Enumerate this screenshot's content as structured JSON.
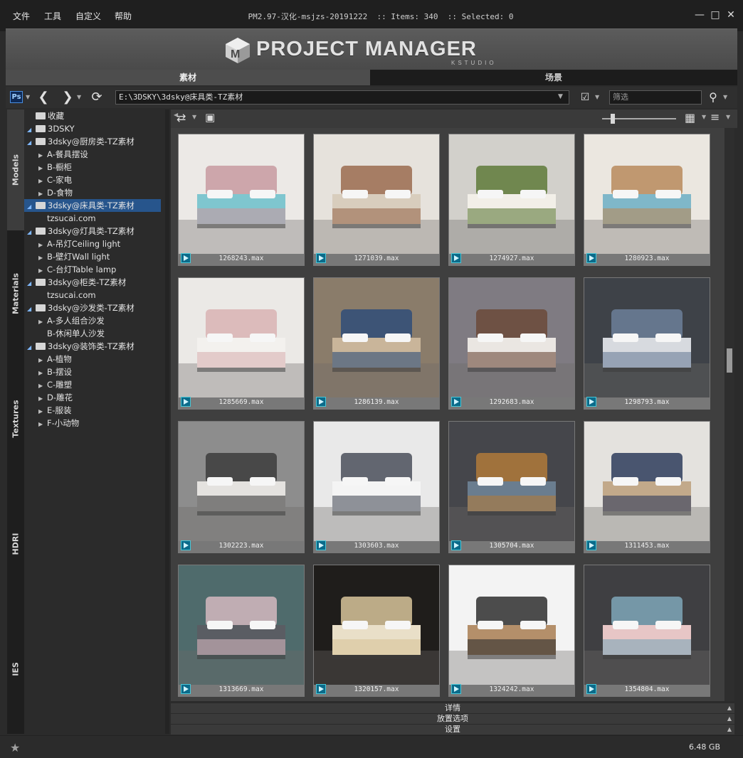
{
  "menu": [
    "文件",
    "工具",
    "自定义",
    "帮助"
  ],
  "title": "PM2.97-汉化-msjzs-20191222  :: Items: 340  :: Selected: 0",
  "banner": {
    "logo_text": "PROJECT MANAGER",
    "logo_sub": "KSTUDIO"
  },
  "tabs": {
    "assets": "素材",
    "scene": "场景"
  },
  "nav": {
    "path": "E:\\3DSKY\\3dsky@床具类-TZ素材",
    "filter_placeholder": "筛选",
    "ps_label": "Ps"
  },
  "vtabs": [
    "Models",
    "Materials",
    "Textures",
    "HDRI",
    "IES"
  ],
  "tree": [
    {
      "label": "收藏",
      "level": 0,
      "toggle": "",
      "star": true
    },
    {
      "label": "3DSKY",
      "level": 0,
      "toggle": "open"
    },
    {
      "label": "3dsky@厨房类-TZ素材",
      "level": 1,
      "toggle": "open"
    },
    {
      "label": "A-餐具摆设",
      "level": 2,
      "toggle": "closed"
    },
    {
      "label": "B-橱柜",
      "level": 2,
      "toggle": "closed"
    },
    {
      "label": "C-家电",
      "level": 2,
      "toggle": "closed"
    },
    {
      "label": "D-食物",
      "level": 2,
      "toggle": "closed"
    },
    {
      "label": "3dsky@床具类-TZ素材",
      "level": 1,
      "toggle": "open",
      "selected": true
    },
    {
      "label": "tzsucai.com",
      "level": 2,
      "toggle": ""
    },
    {
      "label": "3dsky@灯具类-TZ素材",
      "level": 1,
      "toggle": "open"
    },
    {
      "label": "A-吊灯Ceiling light",
      "level": 2,
      "toggle": "closed"
    },
    {
      "label": "B-壁灯Wall light",
      "level": 2,
      "toggle": "closed"
    },
    {
      "label": "C-台灯Table lamp",
      "level": 2,
      "toggle": "closed"
    },
    {
      "label": "3dsky@柜类-TZ素材",
      "level": 1,
      "toggle": "open"
    },
    {
      "label": "tzsucai.com",
      "level": 2,
      "toggle": ""
    },
    {
      "label": "3dsky@沙发类-TZ素材",
      "level": 1,
      "toggle": "open"
    },
    {
      "label": "A-多人组合沙发",
      "level": 2,
      "toggle": "closed"
    },
    {
      "label": "B-休闲单人沙发",
      "level": 2,
      "toggle": ""
    },
    {
      "label": "3dsky@装饰类-TZ素材",
      "level": 1,
      "toggle": "open"
    },
    {
      "label": "A-植物",
      "level": 2,
      "toggle": "closed"
    },
    {
      "label": "B-摆设",
      "level": 2,
      "toggle": "closed"
    },
    {
      "label": "C-雕塑",
      "level": 2,
      "toggle": "closed"
    },
    {
      "label": "D-雕花",
      "level": 2,
      "toggle": "closed"
    },
    {
      "label": "E-服装",
      "level": 2,
      "toggle": "closed"
    },
    {
      "label": "F-小动物",
      "level": 2,
      "toggle": "closed"
    }
  ],
  "items": [
    {
      "name": "1268243.max",
      "c1": "#ece9e6",
      "c2": "#c89aa0",
      "c3": "#7fc6cf"
    },
    {
      "name": "1271039.max",
      "c1": "#e6e2dc",
      "c2": "#9a6b4f",
      "c3": "#d8cdbd"
    },
    {
      "name": "1274927.max",
      "c1": "#d2d0cb",
      "c2": "#5f7a3a",
      "c3": "#f2efe8"
    },
    {
      "name": "1280923.max",
      "c1": "#ebe7e0",
      "c2": "#b98a5c",
      "c3": "#7fb7c9"
    },
    {
      "name": "1285669.max",
      "c1": "#ebe9e6",
      "c2": "#d9b3b3",
      "c3": "#f3f1ee"
    },
    {
      "name": "1286139.max",
      "c1": "#8a7c6a",
      "c2": "#2f4e78",
      "c3": "#c9b59a"
    },
    {
      "name": "1292683.max",
      "c1": "#7f7b82",
      "c2": "#6b4a3a",
      "c3": "#eae6e2"
    },
    {
      "name": "1298793.max",
      "c1": "#3e4248",
      "c2": "#6c7f9a",
      "c3": "#d7dadf"
    },
    {
      "name": "1302223.max",
      "c1": "#8d8d8d",
      "c2": "#3c3c3c",
      "c3": "#e4e2df"
    },
    {
      "name": "1303603.max",
      "c1": "#e9e9e9",
      "c2": "#4a4f5a",
      "c3": "#f4f4f4"
    },
    {
      "name": "1305704.max",
      "c1": "#45464b",
      "c2": "#b07a3a",
      "c3": "#6a7d8f"
    },
    {
      "name": "1311453.max",
      "c1": "#e4e2de",
      "c2": "#2e3c5c",
      "c3": "#c2a98a"
    },
    {
      "name": "1313669.max",
      "c1": "#4f6b6c",
      "c2": "#d3b8c0",
      "c3": "#5a5d63"
    },
    {
      "name": "1320157.max",
      "c1": "#1f1d1b",
      "c2": "#d8c49a",
      "c3": "#e9dfc8"
    },
    {
      "name": "1324242.max",
      "c1": "#f3f3f3",
      "c2": "#2e2e2e",
      "c3": "#b48f6a"
    },
    {
      "name": "1354804.max",
      "c1": "#3f3f42",
      "c2": "#7fa7b8",
      "c3": "#e7c6c6"
    }
  ],
  "panels": [
    "详情",
    "放置选项",
    "设置"
  ],
  "status": {
    "disk": "6.48 GB"
  }
}
